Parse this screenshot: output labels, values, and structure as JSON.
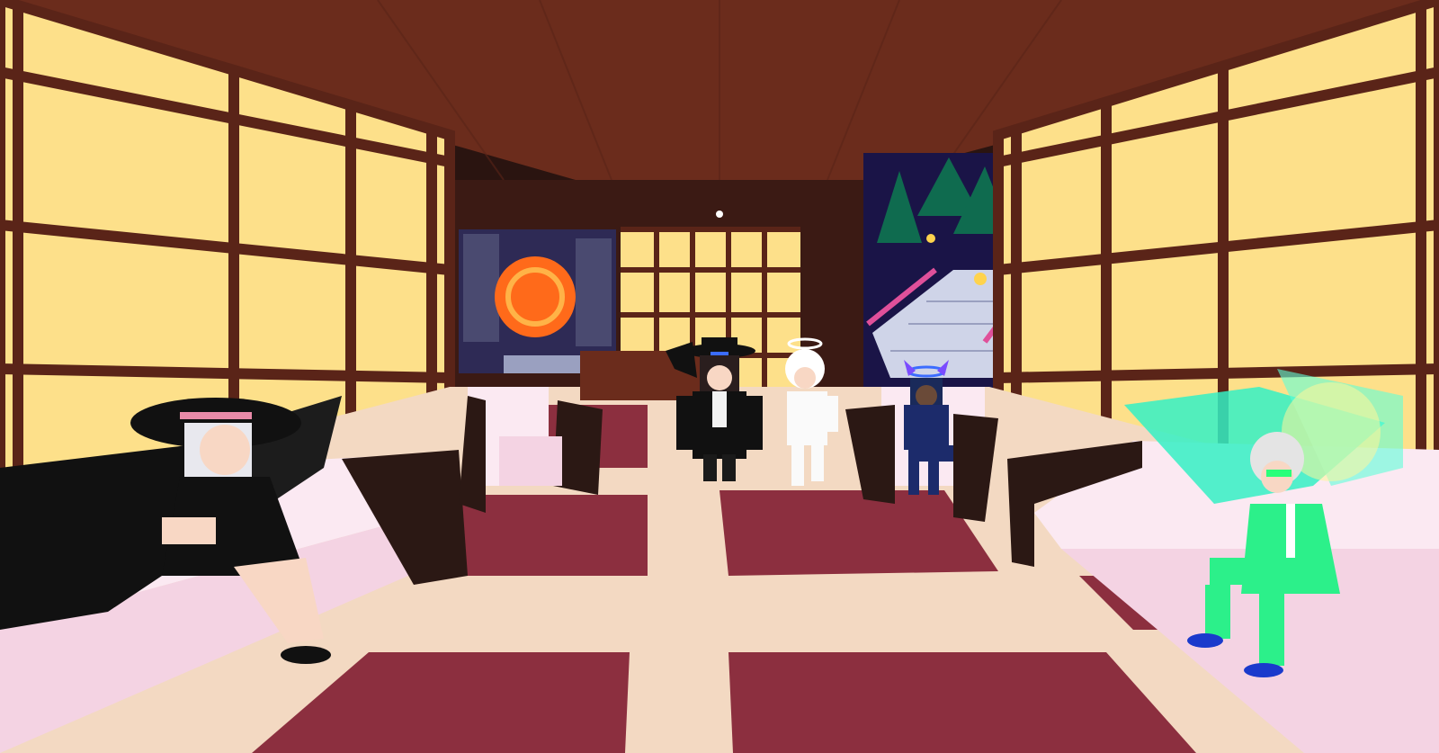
{
  "scene": {
    "colors": {
      "paper_panel": "#fde08a",
      "wood_frame": "#5a2418",
      "ceiling": "#6b2c1c",
      "floor_rug": "#8c2f3f",
      "floor_strip": "#f3d9c2",
      "sofa_white": "#fbe9f2",
      "sofa_frame": "#2b1814",
      "night_sky": "#1a1447",
      "lava_sun": "#ff6a1a",
      "pine_green": "#0f6b4f",
      "staircase": "#cfd4e8",
      "railing": "#e0509a"
    },
    "characters": [
      {
        "icon": "winged-woman-black-dress-icon"
      },
      {
        "icon": "top-hat-man-black-coat-icon"
      },
      {
        "icon": "white-suit-angel-icon"
      },
      {
        "icon": "blue-devil-horns-icon"
      },
      {
        "icon": "green-suit-glowing-halo-icon"
      }
    ]
  }
}
